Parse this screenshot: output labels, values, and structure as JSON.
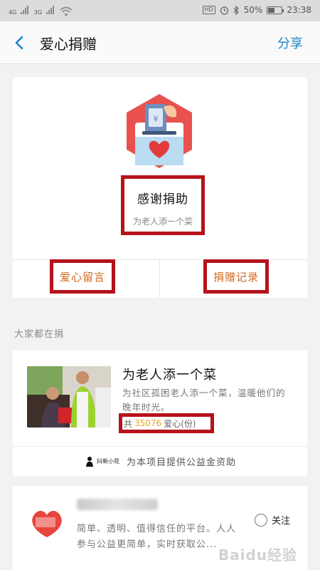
{
  "status_bar": {
    "network_1": "4G",
    "network_2": "3G",
    "hd": "HD",
    "battery": "50%",
    "battery_level": 0.5,
    "time": "23:38",
    "icons": [
      "signal-icon",
      "wifi-icon",
      "alarm-icon",
      "bluetooth-icon",
      "battery-icon"
    ]
  },
  "nav": {
    "title": "爱心捐赠",
    "share": "分享"
  },
  "donation_card": {
    "thanks_title": "感谢捐助",
    "thanks_subtitle": "为老人添一个菜",
    "message_button": "爱心留言",
    "records_button": "捐赠记录"
  },
  "section_title": "大家都在捐",
  "project": {
    "title": "为老人添一个菜",
    "description": "为社区孤困老人添一个菜，温暖他们的晚年时光。",
    "love_prefix": "共",
    "love_count": "35076",
    "love_suffix": "爱心(份)",
    "sponsor_logo_text": "抖新小花",
    "sponsor_text": "为本项目提供公益金资助"
  },
  "org": {
    "description": "简单、透明、值得信任的平台。人人参与公益更简单，实时获取公...",
    "follow": "关注"
  },
  "watermark": "Baidu经验",
  "colors": {
    "highlight_border": "#b5121b",
    "accent_blue": "#1a86c8",
    "love_count": "#e8a21a",
    "action_text": "#d2691e"
  }
}
